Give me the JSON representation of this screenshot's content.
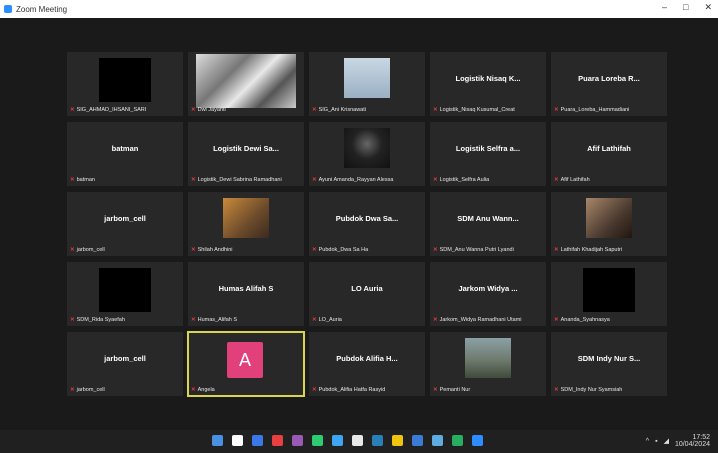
{
  "window": {
    "title": "Zoom Meeting",
    "controls": [
      "–",
      "□",
      "✕"
    ]
  },
  "tiles": [
    {
      "display_name": "",
      "label": "SIG_AHMAD_IHSANI_SARI",
      "video": "black",
      "selected": false
    },
    {
      "display_name": "",
      "label": "Dwi Jayanti",
      "video": "wide",
      "selected": false
    },
    {
      "display_name": "",
      "label": "SIG_Ani Krisnawati",
      "video": "light",
      "selected": false
    },
    {
      "display_name": "Logistik Nisaq K...",
      "label": "Logistik_Nisaq Kusumal_Creat",
      "video": "none",
      "selected": false
    },
    {
      "display_name": "Puara Loreba R...",
      "label": "Puara_Loreba_Hammadiani",
      "video": "none",
      "selected": false
    },
    {
      "display_name": "batman",
      "label": "batman",
      "video": "none",
      "selected": false
    },
    {
      "display_name": "Logistik Dewi Sa...",
      "label": "Logistik_Dewi Sabrina Ramadhani",
      "video": "none",
      "selected": false
    },
    {
      "display_name": "",
      "label": "Ayuni Amanda_Rayyan Alessa",
      "video": "dark",
      "selected": false
    },
    {
      "display_name": "Logistik Selfra a...",
      "label": "Logistik_Selfra Aulia",
      "video": "none",
      "selected": false
    },
    {
      "display_name": "Afif Lathifah",
      "label": "Afif Lathifah",
      "video": "none",
      "selected": false
    },
    {
      "display_name": "jarbom_cell",
      "label": "jarbom_cell",
      "video": "none",
      "selected": false
    },
    {
      "display_name": "",
      "label": "Shilah Andhini",
      "video": "warm",
      "selected": false
    },
    {
      "display_name": "Pubdok Dwa Sa...",
      "label": "Pubdok_Dwa Sa Ha",
      "video": "none",
      "selected": false
    },
    {
      "display_name": "SDM Anu Wann...",
      "label": "SDM_Anu Wanna Putri Lyandi",
      "video": "none",
      "selected": false
    },
    {
      "display_name": "",
      "label": "Lathifah Khadijah Saputri",
      "video": "brown",
      "selected": false
    },
    {
      "display_name": "",
      "label": "SDM_Rida Syaefah",
      "video": "black",
      "selected": false
    },
    {
      "display_name": "Humas Alifah S",
      "label": "Humas_Alifah S",
      "video": "none",
      "selected": false
    },
    {
      "display_name": "LO Auria",
      "label": "LO_Auria",
      "video": "none",
      "selected": false
    },
    {
      "display_name": "Jarkom Widya ...",
      "label": "Jarkom_Widya Ramadhani Utami",
      "video": "none",
      "selected": false
    },
    {
      "display_name": "",
      "label": "Ananda_Syahnasya",
      "video": "black",
      "selected": false
    },
    {
      "display_name": "jarbom_cell",
      "label": "jarbom_cell",
      "video": "none",
      "selected": false
    },
    {
      "display_name": "",
      "label": "Angela",
      "video": "avatar",
      "avatar_letter": "A",
      "selected": true
    },
    {
      "display_name": "Pubdok Alifia H...",
      "label": "Pubdok_Alifia Hatfa Rasyid",
      "video": "none",
      "selected": false
    },
    {
      "display_name": "",
      "label": "Pemanti Nur",
      "video": "outdoor",
      "selected": false
    },
    {
      "display_name": "SDM Indy Nur S...",
      "label": "SDM_Indy Nur Syamsiah",
      "video": "none",
      "selected": false
    }
  ],
  "taskbar": {
    "icon_colors": [
      "#4a90e2",
      "#ffffff",
      "#3b78e7",
      "#e84040",
      "#9b59b6",
      "#2ecc71",
      "#3da5f4",
      "#e8e8e8",
      "#2980b9",
      "#f1c40f",
      "#3a7bd5",
      "#5dade2",
      "#27ae60",
      "#2d8cff"
    ],
    "time": "17:52",
    "date": "10/04/2024"
  }
}
